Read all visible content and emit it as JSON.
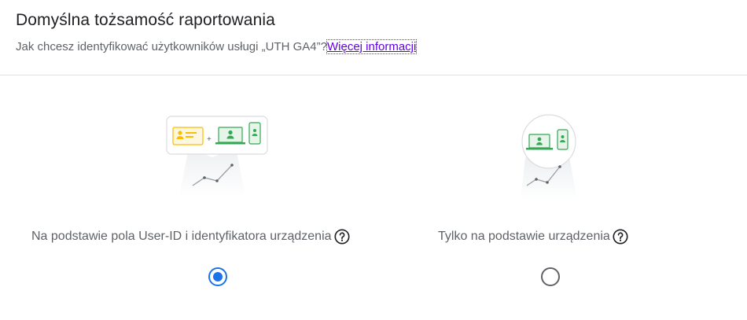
{
  "header": {
    "title": "Domyślna tożsamość raportowania",
    "subtitle_text": "Jak chcesz identyfikować użytkowników usługi „UTH GA4”?",
    "more_info_link": "Więcej informacji"
  },
  "options": [
    {
      "label": "Na podstawie pola User-ID i identyfikatora urządzenia",
      "selected": true,
      "icons": [
        "user-id-card-icon",
        "laptop-user-icon",
        "phone-user-icon",
        "trend-chart-icon",
        "help-icon"
      ]
    },
    {
      "label": "Tylko na podstawie urządzenia",
      "selected": false,
      "icons": [
        "laptop-user-icon",
        "phone-user-icon",
        "trend-chart-icon",
        "help-icon"
      ]
    }
  ],
  "colors": {
    "accent": "#1a73e8",
    "link": "#6200ea",
    "green": "#34a853",
    "yellow": "#fbbc04",
    "text_secondary": "#5f6368"
  }
}
